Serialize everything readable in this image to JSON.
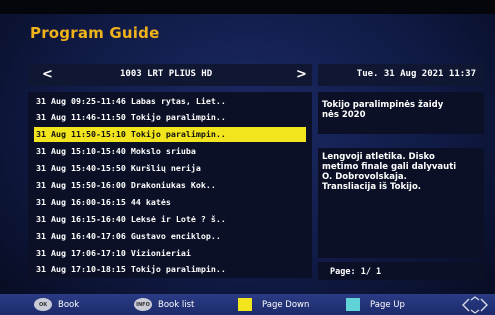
{
  "title": "Program Guide",
  "channel": {
    "prev_arrow": "<",
    "name": "1003  LRT PLIUS HD",
    "next_arrow": ">"
  },
  "datetime": "Tue.  31 Aug 2021 11:37",
  "programs": [
    {
      "text": "31 Aug 09:25-11:46 Labas rytas, Liet..",
      "selected": false
    },
    {
      "text": "31 Aug 11:46-11:50 Tokijo paralimpin..",
      "selected": false
    },
    {
      "text": "31 Aug 11:50-15:10 Tokijo paralimpin..",
      "selected": true
    },
    {
      "text": "31 Aug 15:10-15:40 Mokslo sriuba",
      "selected": false
    },
    {
      "text": "31 Aug 15:40-15:50 Kuršlių nerija",
      "selected": false
    },
    {
      "text": "31 Aug 15:50-16:00 Drakoniukas Kok..",
      "selected": false
    },
    {
      "text": "31 Aug 16:00-16:15 44 katės",
      "selected": false
    },
    {
      "text": "31 Aug 16:15-16:40 Leksė ir Lotė ? š..",
      "selected": false
    },
    {
      "text": "31 Aug 16:40-17:06 Gustavo enciklop..",
      "selected": false
    },
    {
      "text": "31 Aug 17:06-17:10 Vizionieriai",
      "selected": false
    },
    {
      "text": "31 Aug 17:10-18:15 Tokijo paralimpin..",
      "selected": false
    }
  ],
  "info": {
    "title_line1": "Tokijo paralimpinės žaidy",
    "title_line2": "nės 2020",
    "desc_line1": "Lengvoji atletika. Disko",
    "desc_line2": "metimo finale gali dalyvauti",
    "desc_line3": "O. Dobrovolskaja.",
    "desc_line4": "Transliacija iš Tokijo."
  },
  "page": "Page:  1/ 1",
  "helpbar": {
    "ok_key": "OK",
    "book_label": "Book",
    "info_key": "INFO",
    "book_list_label": "Book list",
    "page_down_label": "Page Down",
    "page_up_label": "Page Up",
    "yellow_color": "#f2e51d",
    "cyan_color": "#5fd3d6"
  }
}
